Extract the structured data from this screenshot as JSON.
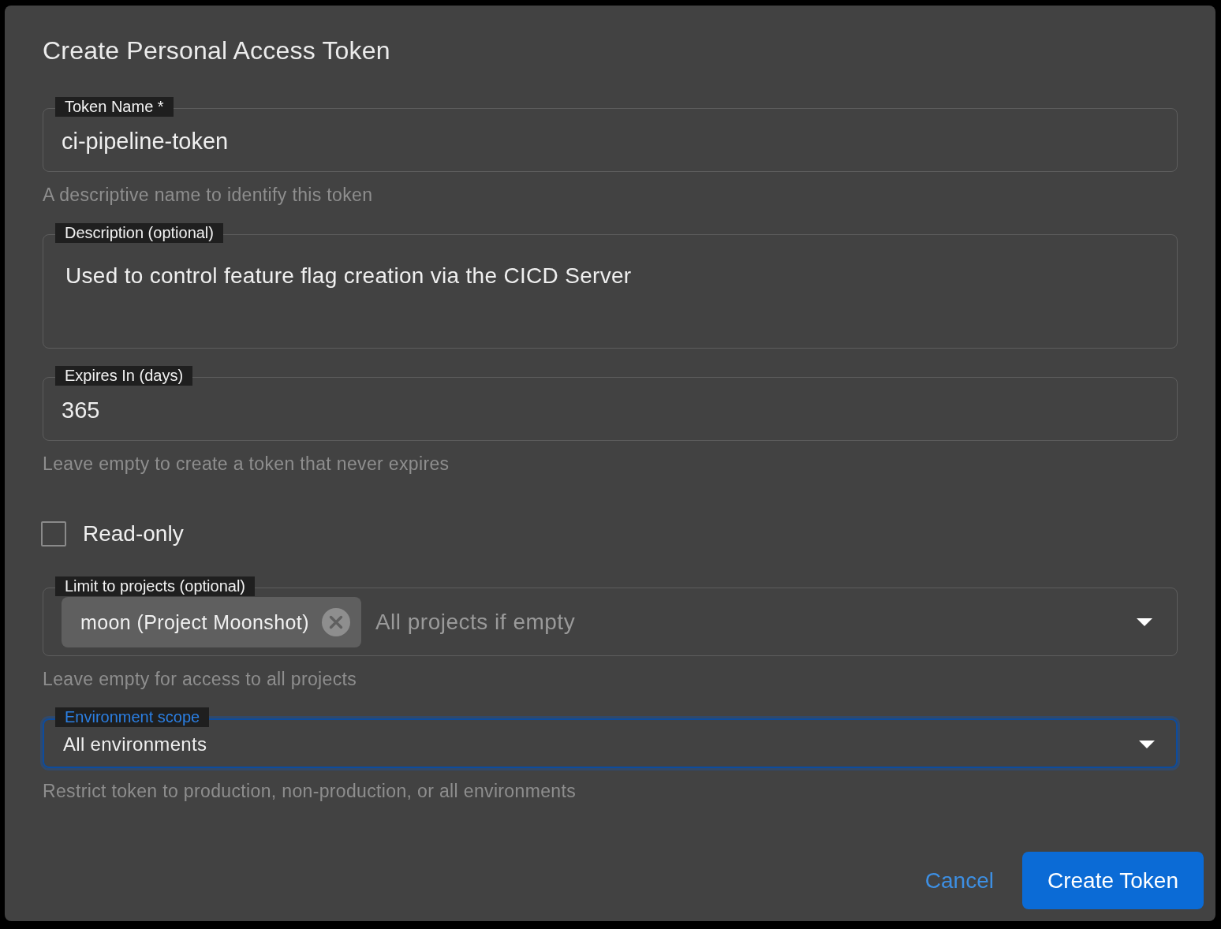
{
  "dialog": {
    "title": "Create Personal Access Token"
  },
  "fields": [
    {
      "kind": "text",
      "label": "Token Name *",
      "value": "ci-pipeline-token",
      "helper": "A descriptive name to identify this token",
      "focused": false
    },
    {
      "kind": "textarea",
      "label": "Description (optional)",
      "value": "Used to control feature flag creation via the CICD Server",
      "focused": false
    },
    {
      "kind": "text",
      "label": "Expires In (days)",
      "value": "365",
      "helper": "Leave empty to create a token that never expires",
      "focused": false
    },
    {
      "kind": "checkbox",
      "label": "Read-only",
      "checked": false,
      "focused": false
    },
    {
      "kind": "multiselect",
      "label": "Limit to projects (optional)",
      "chips": [
        {
          "label": "moon (Project Moonshot)"
        }
      ],
      "placeholder": "All projects if empty",
      "helper": "Leave empty for access to all projects",
      "focused": false
    },
    {
      "kind": "select",
      "label": "Environment scope",
      "value": "All environments",
      "helper": "Restrict token to production, non-production, or all environments",
      "focused": true
    }
  ],
  "buttons": [
    {
      "kind": "text",
      "label": "Cancel"
    },
    {
      "kind": "primary",
      "label": "Create Token"
    }
  ]
}
